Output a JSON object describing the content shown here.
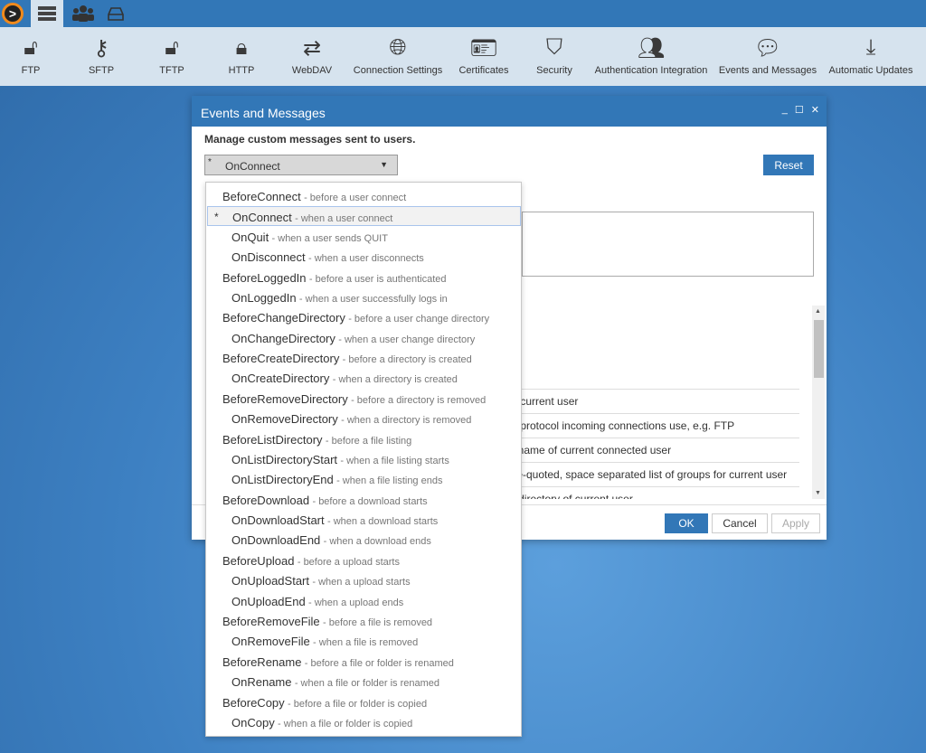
{
  "topbar": {
    "tabs": [
      "logo-icon",
      "server-icon",
      "users-icon",
      "drive-icon"
    ]
  },
  "toolbar": {
    "items": [
      {
        "label": "FTP",
        "icon": "unlock-icon"
      },
      {
        "label": "SFTP",
        "icon": "key-icon"
      },
      {
        "label": "TFTP",
        "icon": "unlock-alt-icon"
      },
      {
        "label": "HTTP",
        "icon": "lock-icon"
      },
      {
        "label": "WebDAV",
        "icon": "retweet-icon"
      },
      {
        "label": "Connection Settings",
        "icon": "globe-icon"
      },
      {
        "label": "Certificates",
        "icon": "id-card-icon"
      },
      {
        "label": "Security",
        "icon": "shield-icon"
      },
      {
        "label": "Authentication Integration",
        "icon": "users-icon"
      },
      {
        "label": "Events and Messages",
        "icon": "comment-icon"
      },
      {
        "label": "Automatic Updates",
        "icon": "download-icon"
      }
    ]
  },
  "dialog": {
    "title": "Events and Messages",
    "subtitle": "Manage custom messages sent to users.",
    "select": {
      "marker": "*",
      "value": "OnConnect"
    },
    "reset": "Reset",
    "variables": [
      "of current user",
      "at protocol incoming connections use, e.g. FTP",
      "ername of current connected user",
      "gle-quoted, space separated list of groups for current user",
      "P directory of current user"
    ],
    "ok": "OK",
    "cancel": "Cancel",
    "apply": "Apply"
  },
  "dropdown": {
    "items": [
      {
        "name": "BeforeConnect",
        "desc": "- before a user connect",
        "sub": false
      },
      {
        "name": "OnConnect",
        "desc": "- when a user connect",
        "sub": true,
        "selected": true,
        "marker": "*"
      },
      {
        "name": "OnQuit",
        "desc": "- when a user sends QUIT",
        "sub": true
      },
      {
        "name": "OnDisconnect",
        "desc": "- when a user disconnects",
        "sub": true
      },
      {
        "name": "BeforeLoggedIn",
        "desc": "- before a user is authenticated",
        "sub": false
      },
      {
        "name": "OnLoggedIn",
        "desc": "- when a user successfully logs in",
        "sub": true
      },
      {
        "name": "BeforeChangeDirectory",
        "desc": "- before a user change directory",
        "sub": false
      },
      {
        "name": "OnChangeDirectory",
        "desc": "- when a user change directory",
        "sub": true
      },
      {
        "name": "BeforeCreateDirectory",
        "desc": "- before a directory is created",
        "sub": false
      },
      {
        "name": "OnCreateDirectory",
        "desc": "- when a directory is created",
        "sub": true
      },
      {
        "name": "BeforeRemoveDirectory",
        "desc": "- before a directory is removed",
        "sub": false
      },
      {
        "name": "OnRemoveDirectory",
        "desc": "- when a directory is removed",
        "sub": true
      },
      {
        "name": "BeforeListDirectory",
        "desc": "- before a file listing",
        "sub": false
      },
      {
        "name": "OnListDirectoryStart",
        "desc": "- when a file listing starts",
        "sub": true
      },
      {
        "name": "OnListDirectoryEnd",
        "desc": "- when a file listing ends",
        "sub": true
      },
      {
        "name": "BeforeDownload",
        "desc": "- before a download starts",
        "sub": false
      },
      {
        "name": "OnDownloadStart",
        "desc": "- when a download starts",
        "sub": true
      },
      {
        "name": "OnDownloadEnd",
        "desc": "- when a download ends",
        "sub": true
      },
      {
        "name": "BeforeUpload",
        "desc": "- before a upload starts",
        "sub": false
      },
      {
        "name": "OnUploadStart",
        "desc": "- when a upload starts",
        "sub": true
      },
      {
        "name": "OnUploadEnd",
        "desc": "- when a upload ends",
        "sub": true
      },
      {
        "name": "BeforeRemoveFile",
        "desc": "- before a file is removed",
        "sub": false
      },
      {
        "name": "OnRemoveFile",
        "desc": "- when a file is removed",
        "sub": true
      },
      {
        "name": "BeforeRename",
        "desc": "- before a file or folder is renamed",
        "sub": false
      },
      {
        "name": "OnRename",
        "desc": "- when a file or folder is renamed",
        "sub": true
      },
      {
        "name": "BeforeCopy",
        "desc": "- before a file or folder is copied",
        "sub": false
      },
      {
        "name": "OnCopy",
        "desc": "- when a file or folder is copied",
        "sub": true
      }
    ]
  }
}
